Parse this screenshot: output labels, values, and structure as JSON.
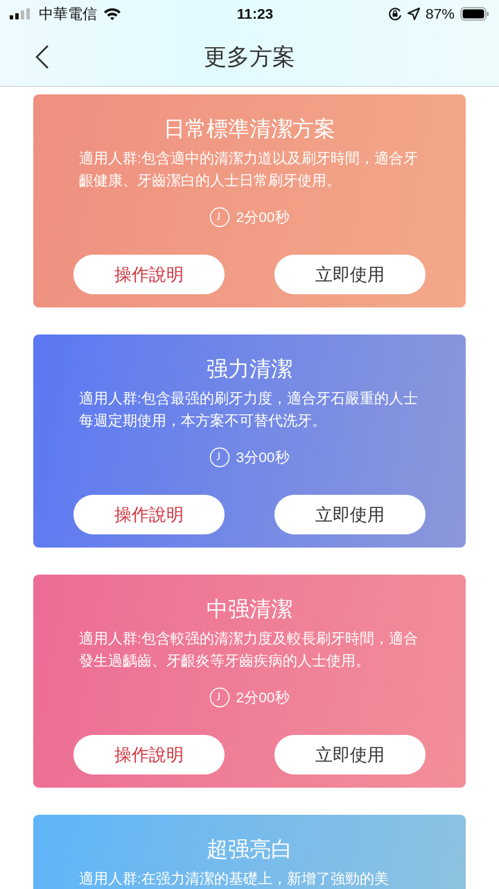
{
  "status_bar": {
    "carrier": "中華電信",
    "time": "11:23",
    "battery": "87%"
  },
  "header": {
    "title": "更多方案"
  },
  "plans": [
    {
      "title": "日常標準清潔方案",
      "description": "適用人群:包含適中的清潔力道以及刷牙時間，適合牙齦健康、牙齒潔白的人士日常刷牙使用。",
      "duration": "2分00秒",
      "color": "#ee9080",
      "buttons": [
        "操作說明",
        "立即使用"
      ]
    },
    {
      "title": "强力清潔",
      "description": "適用人群:包含最强的刷牙力度，適合牙石嚴重的人士每週定期使用，本方案不可替代洗牙。",
      "duration": "3分00秒",
      "color": "#5b78f2",
      "buttons": [
        "操作說明",
        "立即使用"
      ]
    },
    {
      "title": "中强清潔",
      "description": "適用人群:包含較强的清潔力度及較長刷牙時間，適合發生過齲齒、牙齦炎等牙齒疾病的人士使用。",
      "duration": "2分00秒",
      "color": "#ec6c95",
      "buttons": [
        "操作說明",
        "立即使用"
      ]
    },
    {
      "title": "超强亮白",
      "description": "適用人群:在强力清潔的基礎上，新增了強勁的美",
      "color": "#5fb5f8"
    }
  ]
}
